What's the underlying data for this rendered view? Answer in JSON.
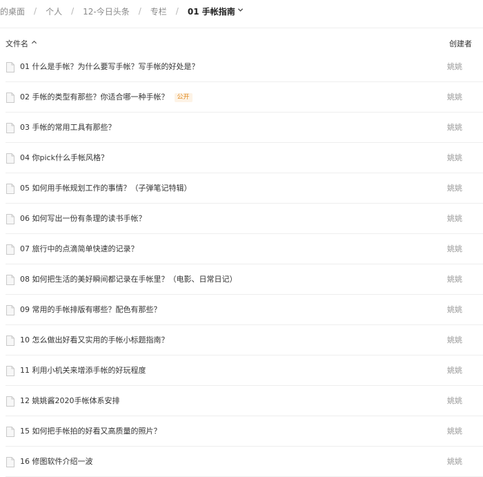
{
  "breadcrumb": {
    "items": [
      "的桌面",
      "个人",
      "12-今日头条",
      "专栏"
    ],
    "current": "01 手帐指南",
    "separator": "/"
  },
  "table": {
    "col_name": "文件名",
    "col_creator": "创建者",
    "rows": [
      {
        "title": "01 什么是手帐？为什么要写手帐？写手帐的好处是？",
        "badge": "",
        "creator": "姚姚"
      },
      {
        "title": "02 手帐的类型有那些？你适合哪一种手帐？",
        "badge": "公开",
        "creator": "姚姚"
      },
      {
        "title": "03 手帐的常用工具有那些？",
        "badge": "",
        "creator": "姚姚"
      },
      {
        "title": "04 你pick什么手帐风格？",
        "badge": "",
        "creator": "姚姚"
      },
      {
        "title": "05 如何用手帐规划工作的事情？（子弹笔记特辑）",
        "badge": "",
        "creator": "姚姚"
      },
      {
        "title": "06 如何写出一份有条理的读书手帐？",
        "badge": "",
        "creator": "姚姚"
      },
      {
        "title": "07 旅行中的点滴简单快速的记录？",
        "badge": "",
        "creator": "姚姚"
      },
      {
        "title": "08 如何把生活的美好瞬间都记录在手帐里？（电影、日常日记）",
        "badge": "",
        "creator": "姚姚"
      },
      {
        "title": "09 常用的手帐排版有哪些？配色有那些？",
        "badge": "",
        "creator": "姚姚"
      },
      {
        "title": "10 怎么做出好看又实用的手帐小标题指南？",
        "badge": "",
        "creator": "姚姚"
      },
      {
        "title": "11 利用小机关来增添手帐的好玩程度",
        "badge": "",
        "creator": "姚姚"
      },
      {
        "title": "12 姚姚酱2020手帐体系安排",
        "badge": "",
        "creator": "姚姚"
      },
      {
        "title": "15 如何把手帐拍的好看又高质量的照片？",
        "badge": "",
        "creator": "姚姚"
      },
      {
        "title": "16 修图软件介绍一波",
        "badge": "",
        "creator": "姚姚"
      }
    ]
  }
}
